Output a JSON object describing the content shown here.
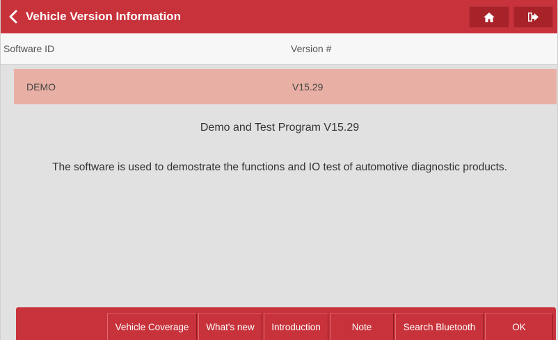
{
  "header": {
    "title": "Vehicle Version Information"
  },
  "table": {
    "columns": [
      "Software ID",
      "Version #"
    ],
    "rows": [
      {
        "software_id": "DEMO",
        "version": "V15.29"
      }
    ]
  },
  "program": {
    "title": "Demo and Test Program V15.29",
    "description": "The software is used to demostrate the functions and IO test of automotive diagnostic products."
  },
  "footer": {
    "buttons": [
      "Vehicle Coverage",
      "What's new",
      "Introduction",
      "Note",
      "Search Bluetooth",
      "OK"
    ]
  },
  "icons": {
    "back": "chevron-left-icon",
    "home": "home-icon",
    "exit": "exit-icon"
  },
  "colors": {
    "brand_red": "#c8323b",
    "selected_row": "#e8b0a4",
    "background": "#e1e1e1"
  }
}
